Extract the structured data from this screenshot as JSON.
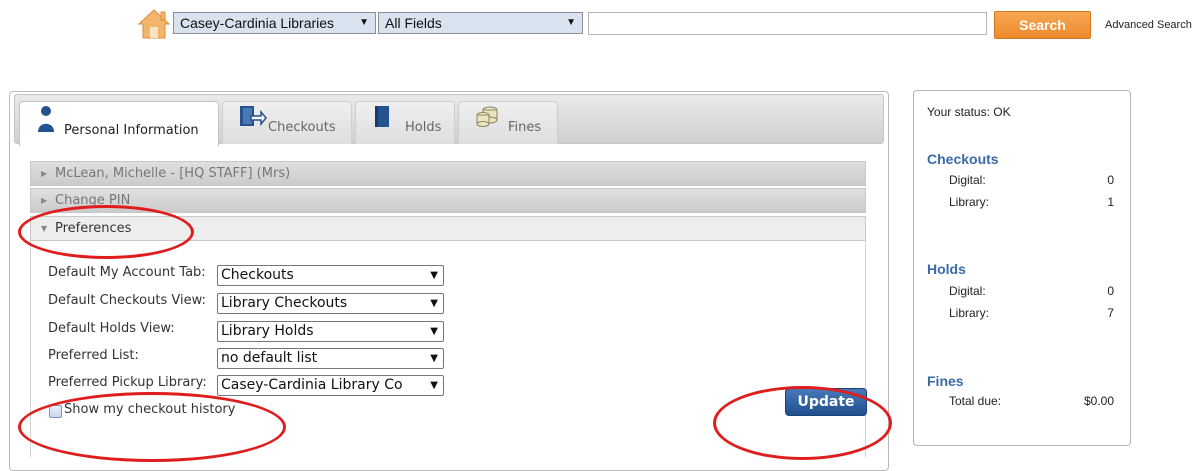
{
  "search": {
    "library_value": "Casey-Cardinia Libraries",
    "field_value": "All Fields",
    "query_value": "",
    "button_label": "Search",
    "advanced_link": "Advanced Search"
  },
  "tabs": [
    {
      "label": "Personal Information",
      "icon": "person-icon",
      "active": true
    },
    {
      "label": "Checkouts",
      "icon": "checkout-icon",
      "active": false
    },
    {
      "label": "Holds",
      "icon": "book-icon",
      "active": false
    },
    {
      "label": "Fines",
      "icon": "coins-icon",
      "active": false
    }
  ],
  "sections": {
    "account": "McLean, Michelle - [HQ STAFF] (Mrs)",
    "pin": "Change PIN",
    "preferences": "Preferences"
  },
  "preferences": {
    "rows": [
      {
        "label": "Default My Account Tab:",
        "value": "Checkouts"
      },
      {
        "label": "Default Checkouts View:",
        "value": "Library Checkouts"
      },
      {
        "label": "Default Holds View:",
        "value": "Library Holds"
      },
      {
        "label": "Preferred List:",
        "value": "no default list"
      },
      {
        "label": "Preferred Pickup Library:",
        "value": "Casey-Cardinia Library Co"
      }
    ],
    "history_label": "Show my checkout history",
    "history_checked": false,
    "update_label": "Update"
  },
  "status": {
    "text": "Your status: OK",
    "checkouts": {
      "title": "Checkouts",
      "digital_label": "Digital:",
      "digital": "0",
      "library_label": "Library:",
      "library": "1"
    },
    "holds": {
      "title": "Holds",
      "digital_label": "Digital:",
      "digital": "0",
      "library_label": "Library:",
      "library": "7"
    },
    "fines": {
      "title": "Fines",
      "total_label": "Total due:",
      "total": "$0.00"
    }
  },
  "colors": {
    "search_button": "#ec8a2c",
    "update_button": "#2a5a9a",
    "heading_blue": "#3a6aa7",
    "annotation_red": "#e01d1d"
  }
}
